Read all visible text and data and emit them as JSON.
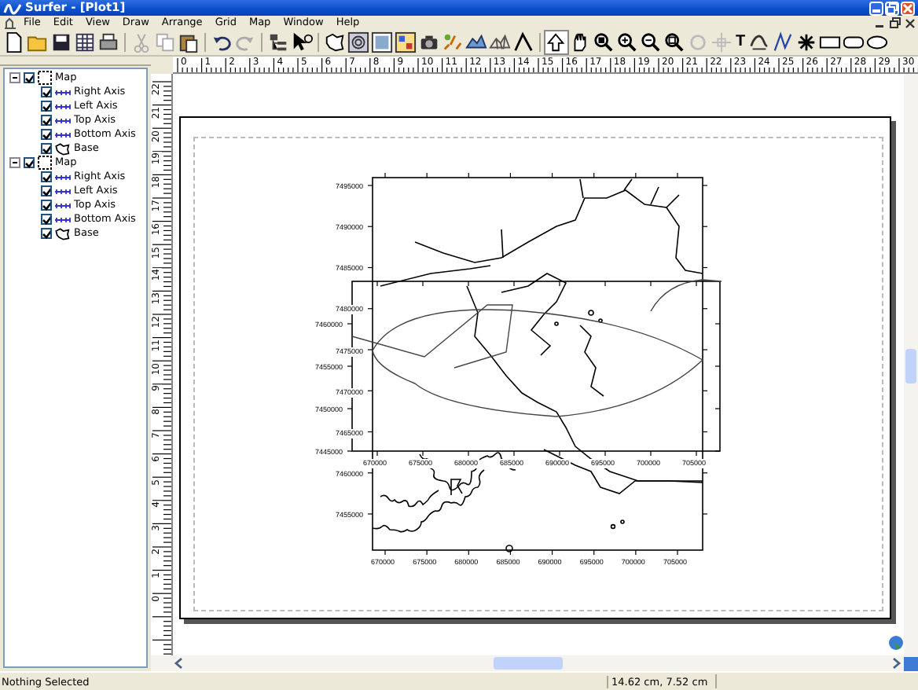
{
  "window": {
    "title": "Surfer - [Plot1]"
  },
  "menu": [
    "File",
    "Edit",
    "View",
    "Draw",
    "Arrange",
    "Grid",
    "Map",
    "Window",
    "Help"
  ],
  "toolbar": {
    "text_tool": "T"
  },
  "rulers": {
    "horizontal": [
      "0",
      "1",
      "2",
      "3",
      "4",
      "5",
      "6",
      "7",
      "8",
      "9",
      "10",
      "11",
      "12",
      "13",
      "14",
      "15",
      "16",
      "17",
      "18",
      "19",
      "20",
      "21",
      "22",
      "23",
      "24",
      "25",
      "26",
      "27",
      "28",
      "29",
      "30"
    ],
    "vertical": [
      "22",
      "21",
      "20",
      "19",
      "18",
      "17",
      "16",
      "15",
      "14",
      "13",
      "12",
      "11",
      "10",
      "9",
      "8",
      "7",
      "6",
      "5",
      "4",
      "3",
      "2",
      "1",
      "0"
    ]
  },
  "tree": [
    {
      "label": "Map",
      "kind": "map",
      "checked": true,
      "expanded": true,
      "children": [
        {
          "label": "Right Axis",
          "kind": "axis",
          "checked": true
        },
        {
          "label": "Left Axis",
          "kind": "axis",
          "checked": true
        },
        {
          "label": "Top Axis",
          "kind": "axis",
          "checked": true
        },
        {
          "label": "Bottom Axis",
          "kind": "axis",
          "checked": true
        },
        {
          "label": "Base",
          "kind": "base",
          "checked": true
        }
      ]
    },
    {
      "label": "Map",
      "kind": "map",
      "checked": true,
      "expanded": true,
      "children": [
        {
          "label": "Right Axis",
          "kind": "axis",
          "checked": true
        },
        {
          "label": "Left Axis",
          "kind": "axis",
          "checked": true
        },
        {
          "label": "Top Axis",
          "kind": "axis",
          "checked": true
        },
        {
          "label": "Bottom Axis",
          "kind": "axis",
          "checked": true
        },
        {
          "label": "Base",
          "kind": "base",
          "checked": true
        }
      ]
    }
  ],
  "plots": [
    {
      "y_labels": [
        "7495000",
        "7490000",
        "7485000",
        "7480000",
        "7475000",
        "7470000",
        "7465000",
        "7460000",
        "7455000"
      ],
      "x_labels": [
        "670000",
        "675000",
        "680000",
        "685000",
        "690000",
        "695000",
        "700000",
        "705000"
      ]
    },
    {
      "y_labels": [
        "7460000",
        "7455000",
        "7450000",
        "7445000"
      ],
      "x_labels": [
        "670000",
        "675000",
        "680000",
        "685000",
        "690000",
        "695000",
        "700000",
        "705000"
      ]
    }
  ],
  "status_bar": {
    "message": "Nothing Selected",
    "position": "14.62 cm, 7.52 cm"
  }
}
